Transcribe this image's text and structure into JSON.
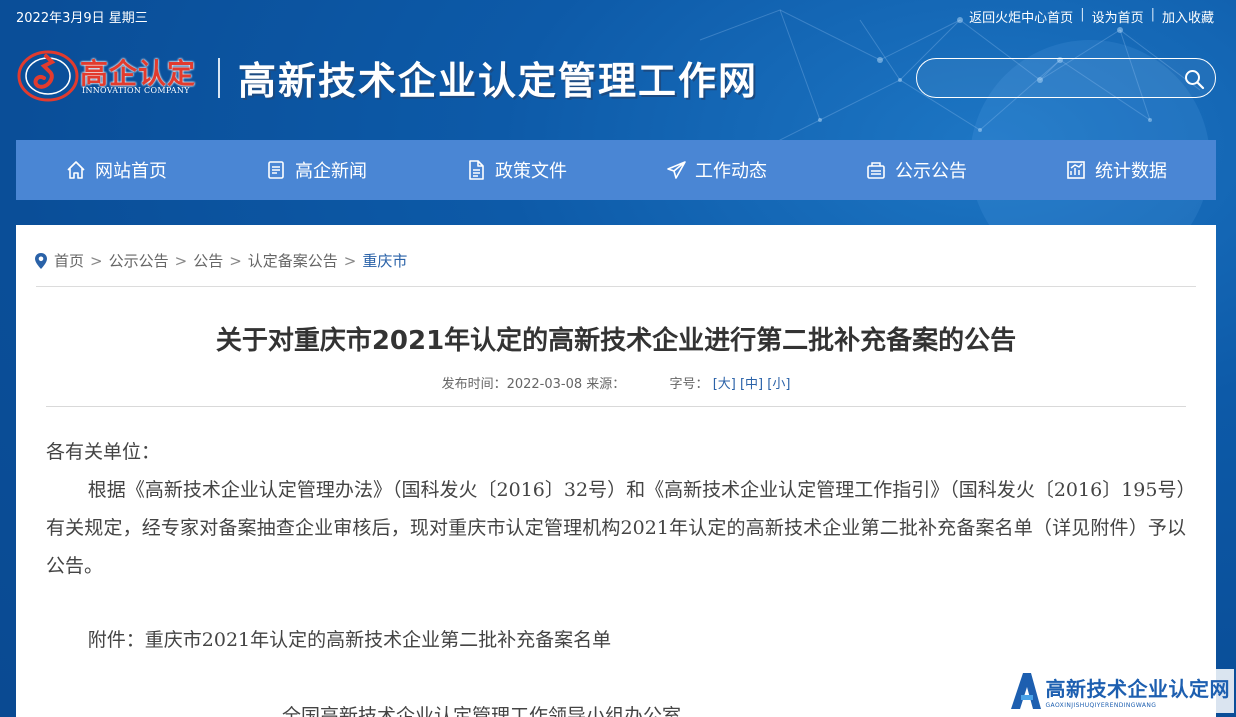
{
  "topbar": {
    "date": "2022年3月9日 星期三",
    "links": [
      "返回火炬中心首页",
      "设为首页",
      "加入收藏"
    ]
  },
  "header": {
    "logo_name": "高企认定",
    "logo_english": "INNOVATION COMPANY",
    "site_title": "高新技术企业认定管理工作网",
    "search_placeholder": ""
  },
  "nav": [
    {
      "label": "网站首页",
      "icon": "home-icon"
    },
    {
      "label": "高企新闻",
      "icon": "news-icon"
    },
    {
      "label": "政策文件",
      "icon": "document-icon"
    },
    {
      "label": "工作动态",
      "icon": "send-icon"
    },
    {
      "label": "公示公告",
      "icon": "announcement-icon"
    },
    {
      "label": "统计数据",
      "icon": "chart-icon"
    }
  ],
  "breadcrumb": {
    "items": [
      "首页",
      "公示公告",
      "公告",
      "认定备案公告"
    ],
    "separator": ">",
    "current": "重庆市"
  },
  "article": {
    "title": "关于对重庆市2021年认定的高新技术企业进行第二批补充备案的公告",
    "meta_publish": "发布时间：2022-03-08 来源：",
    "meta_size_label": "字号：",
    "font_sizes": [
      "[大]",
      "[中]",
      "[小]"
    ],
    "salutation": "各有关单位：",
    "paragraph": "根据《高新技术企业认定管理办法》（国科发火〔2016〕32号）和《高新技术企业认定管理工作指引》（国科发火〔2016〕195号）有关规定，经专家对备案抽查企业审核后，现对重庆市认定管理机构2021年认定的高新技术企业第二批补充备案名单（详见附件）予以公告。",
    "attachment": "附件：重庆市2021年认定的高新技术企业第二批补充备案名单",
    "signature": "全国高新技术企业认定管理工作领导小组办公室"
  },
  "watermark": {
    "text": "高新技术企业认定网",
    "pinyin": "GAOXINJISHUQIYERENDINGWANG"
  },
  "colors": {
    "header_bg": "#0d5aa8",
    "nav_bg": "#4a86d4",
    "link_blue": "#2a62a8",
    "logo_red": "#e23b2e"
  }
}
